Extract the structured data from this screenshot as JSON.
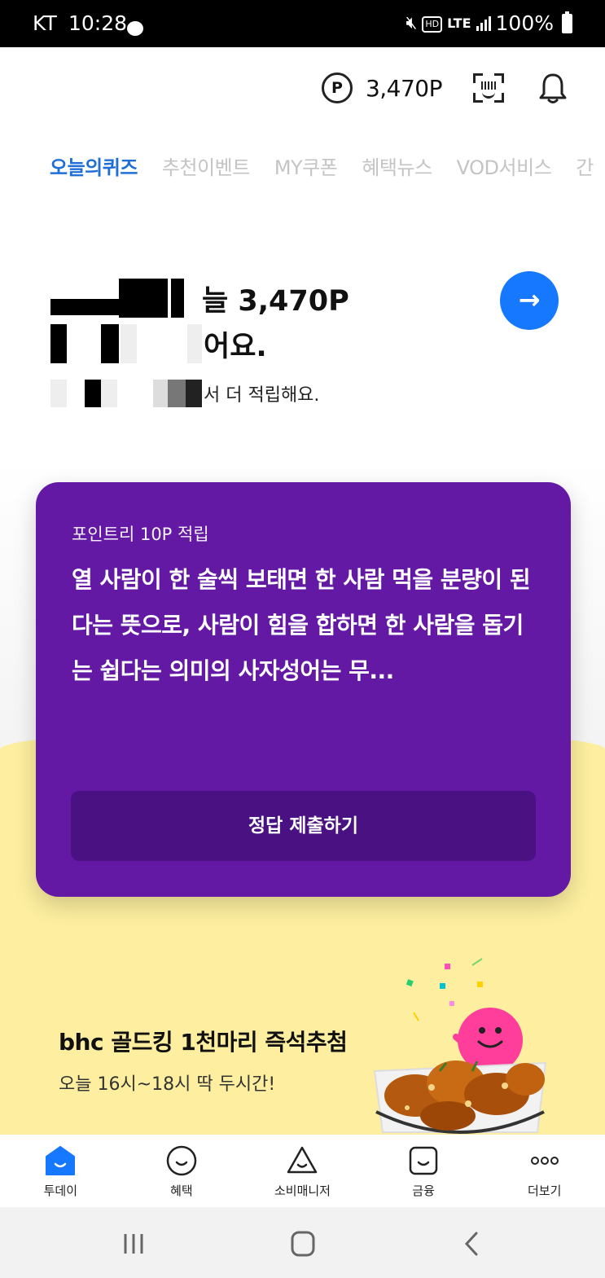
{
  "status_bar": {
    "carrier": "KT",
    "time": "10:28",
    "network": "LTE",
    "hd": "HD",
    "battery": "100%"
  },
  "header": {
    "points_symbol": "P",
    "points": "3,470P"
  },
  "tabs": [
    {
      "label": "오늘의퀴즈",
      "active": true
    },
    {
      "label": "추천이벤트",
      "active": false
    },
    {
      "label": "MY쿠폰",
      "active": false
    },
    {
      "label": "혜택뉴스",
      "active": false
    },
    {
      "label": "VOD서비스",
      "active": false
    },
    {
      "label": "간",
      "active": false
    }
  ],
  "hero": {
    "line1_suffix": "늘 3,470P",
    "line2_suffix": "어요.",
    "subtitle_suffix": "서 더 적립해요.",
    "arrow": "→"
  },
  "quiz": {
    "label": "포인트리 10P 적립",
    "question": "열 사람이 한 술씩 보태면 한 사람 먹을 분량이 된다는 뜻으로, 사람이 힘을 합하면 한 사람을 돕기는 쉽다는 의미의 사자성어는 무...",
    "submit_label": "정답 제출하기"
  },
  "promo": {
    "title": "bhc 골드킹 1천마리 즉석추첨",
    "subtitle": "오늘 16시~18시 딱 두시간!"
  },
  "bottom_nav": [
    {
      "label": "투데이",
      "icon": "home-icon",
      "active": true
    },
    {
      "label": "혜택",
      "icon": "smile-circle-icon",
      "active": false
    },
    {
      "label": "소비매니저",
      "icon": "triangle-smile-icon",
      "active": false
    },
    {
      "label": "금융",
      "icon": "square-smile-icon",
      "active": false
    },
    {
      "label": "더보기",
      "icon": "more-icon",
      "active": false
    }
  ],
  "colors": {
    "accent_blue": "#1677ff",
    "tab_active": "#1f6fd6",
    "quiz_purple": "#6319a4",
    "submit_purple": "#4a1183",
    "promo_yellow": "#fdef9f"
  }
}
